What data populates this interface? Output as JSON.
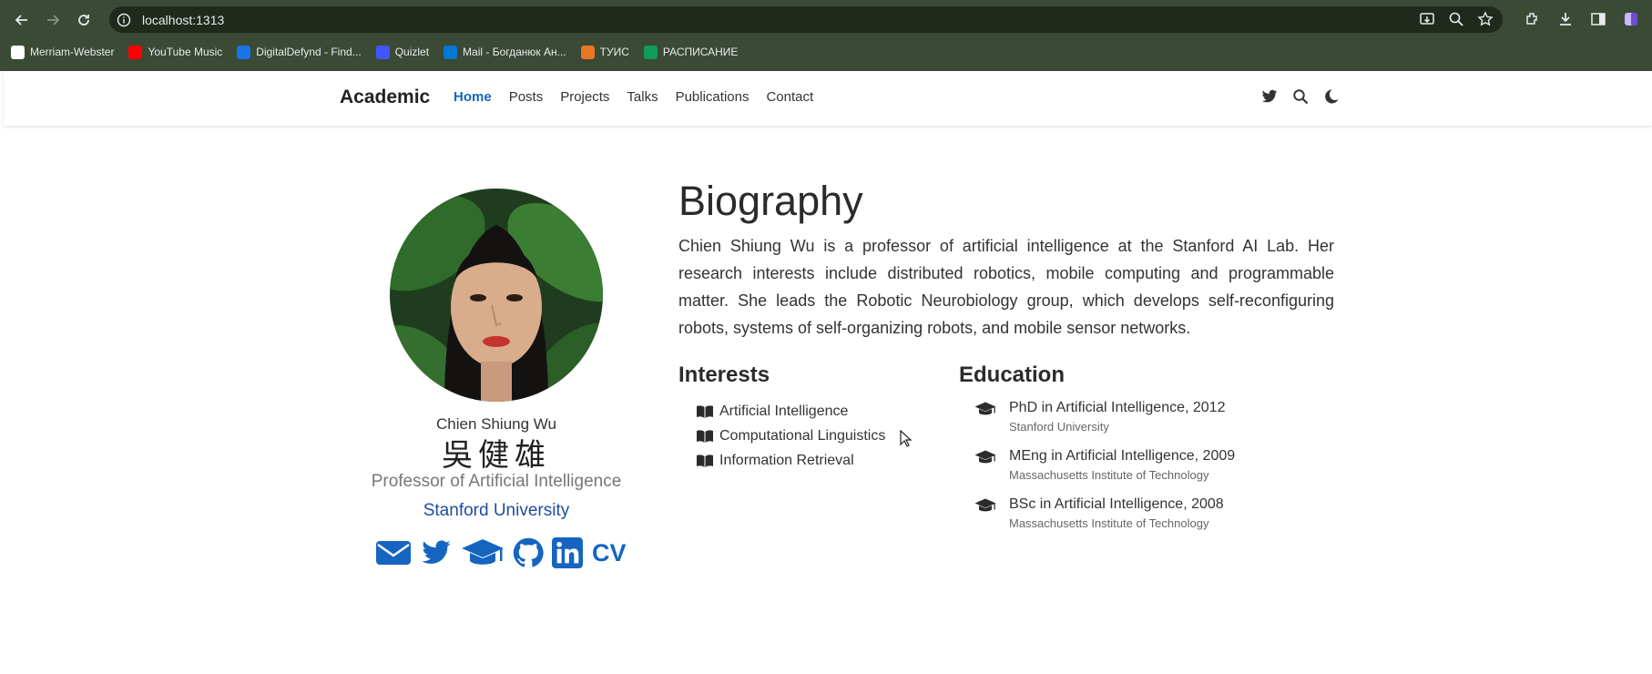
{
  "browser": {
    "url": "localhost:1313",
    "bookmarks": [
      {
        "label": "Merriam-Webster",
        "icon": "mw-icon",
        "color": "#ffffff"
      },
      {
        "label": "YouTube Music",
        "icon": "youtube-music-icon",
        "color": "#ff0000"
      },
      {
        "label": "DigitalDefynd - Find...",
        "icon": "dd-icon",
        "color": "#1a73e8"
      },
      {
        "label": "Quizlet",
        "icon": "quizlet-icon",
        "color": "#4255ff"
      },
      {
        "label": "Mail - Богданюк Ан...",
        "icon": "outlook-icon",
        "color": "#0078d4"
      },
      {
        "label": "ТУИС",
        "icon": "tuis-icon",
        "color": "#e87722"
      },
      {
        "label": "РАСПИСАНИЕ",
        "icon": "sheets-icon",
        "color": "#0f9d58"
      }
    ]
  },
  "site": {
    "brand": "Academic",
    "nav": [
      "Home",
      "Posts",
      "Projects",
      "Talks",
      "Publications",
      "Contact"
    ],
    "active_nav": "Home",
    "accent": "#1565c0"
  },
  "profile": {
    "name": "Chien Shiung Wu",
    "name_cjk": "吳健雄",
    "role": "Professor of Artificial Intelligence",
    "organization": "Stanford University",
    "social": [
      "envelope-icon",
      "twitter-icon",
      "graduation-cap-icon",
      "github-icon",
      "linkedin-icon",
      "CV"
    ]
  },
  "biography": {
    "title": "Biography",
    "text": "Chien Shiung Wu is a professor of artificial intelligence at the Stanford AI Lab. Her research interests include distributed robotics, mobile computing and programmable matter. She leads the Robotic Neurobiology group, which develops self-reconfiguring robots, systems of self-organizing robots, and mobile sensor networks."
  },
  "interests": {
    "title": "Interests",
    "items": [
      "Artificial Intelligence",
      "Computational Linguistics",
      "Information Retrieval"
    ]
  },
  "education": {
    "title": "Education",
    "items": [
      {
        "degree": "PhD in Artificial Intelligence, 2012",
        "school": "Stanford University"
      },
      {
        "degree": "MEng in Artificial Intelligence, 2009",
        "school": "Massachusetts Institute of Technology"
      },
      {
        "degree": "BSc in Artificial Intelligence, 2008",
        "school": "Massachusetts Institute of Technology"
      }
    ]
  }
}
